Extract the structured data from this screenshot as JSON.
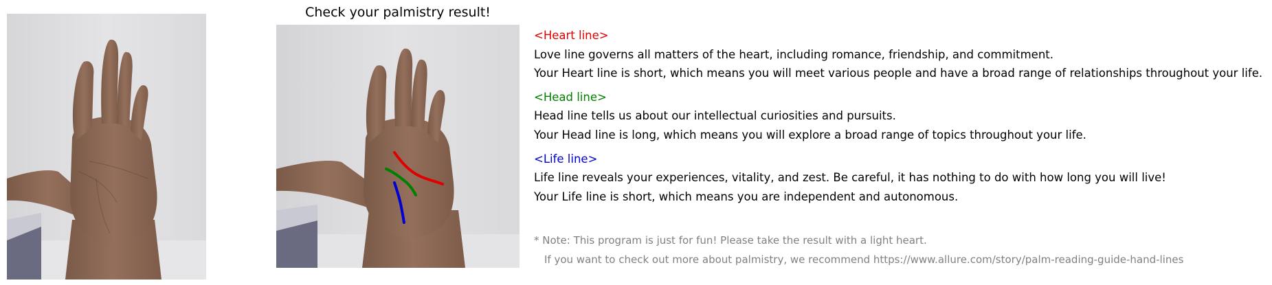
{
  "title": "Check your palmistry result!",
  "colors": {
    "heart": "#e00000",
    "head": "#008000",
    "life": "#0000d0",
    "note": "#808080",
    "background_wall": "#dedede",
    "skin": "#8a6652"
  },
  "sections": {
    "heart": {
      "heading": "<Heart line>",
      "desc": "Love line governs all matters of the heart, including romance, friendship, and commitment.",
      "result": "Your Heart line is short, which means you will meet various people and have a broad range of relationships throughout your life."
    },
    "head": {
      "heading": "<Head line>",
      "desc": "Head line tells us about our intellectual curiosities and pursuits.",
      "result": "Your Head line is long, which means you will explore a broad range of topics throughout your life."
    },
    "life": {
      "heading": "<Life line>",
      "desc": "Life line reveals your experiences, vitality, and zest. Be careful, it has nothing to do with how long you will live!",
      "result": "Your Life line is short, which means you are independent and autonomous."
    }
  },
  "note": {
    "line1": "* Note: This program is just for fun! Please take the result with a light heart.",
    "line2": "If you want to check out more about palmistry, we recommend https://www.allure.com/story/palm-reading-guide-hand-lines"
  }
}
